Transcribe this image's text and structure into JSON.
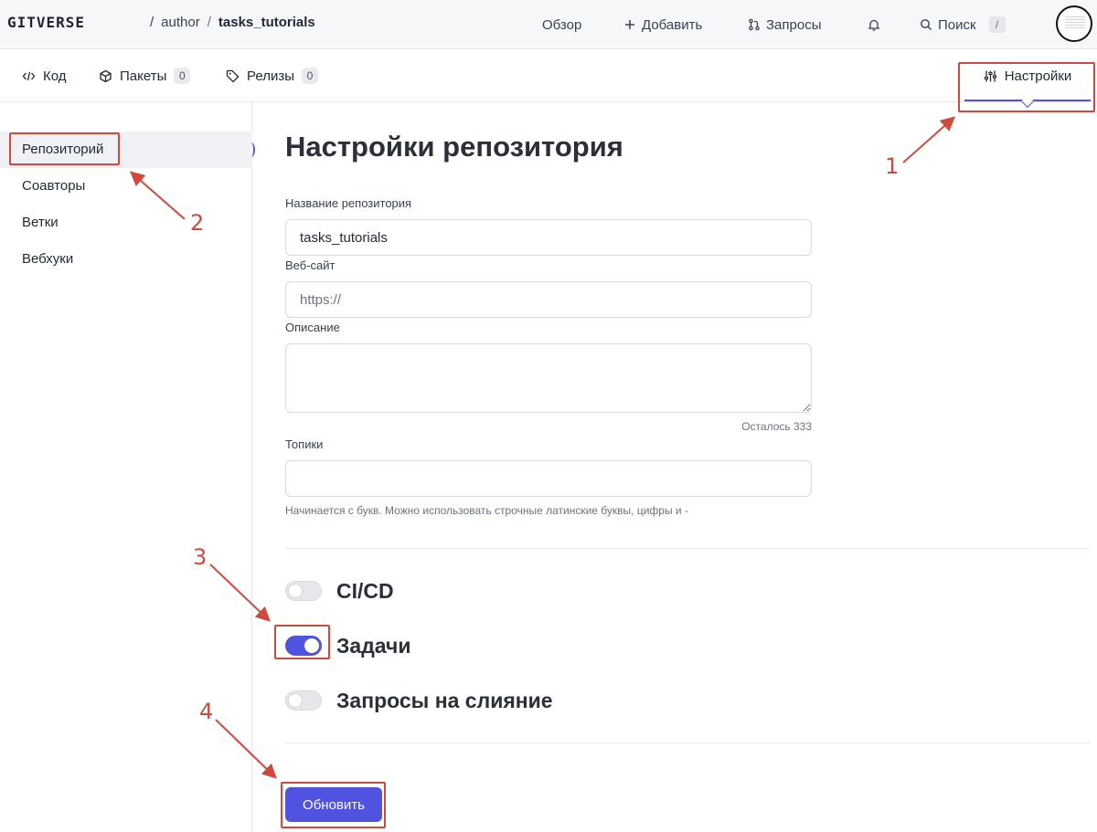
{
  "header": {
    "logo": "GITVERSE",
    "breadcrumb": {
      "owner": "author",
      "separator": "/",
      "repo": "tasks_tutorials"
    },
    "nav": {
      "overview": "Обзор",
      "add": "Добавить",
      "requests": "Запросы",
      "search": "Поиск",
      "search_shortcut": "/"
    }
  },
  "tabs": {
    "code": "Код",
    "packages": "Пакеты",
    "packages_count": "0",
    "releases": "Релизы",
    "releases_count": "0",
    "settings": "Настройки"
  },
  "sidebar": {
    "items": [
      {
        "label": "Репозиторий",
        "active": true
      },
      {
        "label": "Соавторы"
      },
      {
        "label": "Ветки"
      },
      {
        "label": "Вебхуки"
      }
    ]
  },
  "main": {
    "title": "Настройки репозитория",
    "repo_name_label": "Название репозитория",
    "repo_name_value": "tasks_tutorials",
    "website_label": "Веб-сайт",
    "website_placeholder": "https://",
    "description_label": "Описание",
    "description_value": "",
    "remaining": "Осталось 333",
    "topics_label": "Топики",
    "topics_value": "",
    "topics_hint": "Начинается с букв. Можно использовать строчные латинские буквы, цифры и -",
    "toggles": [
      {
        "label": "CI/CD",
        "on": false
      },
      {
        "label": "Задачи",
        "on": true
      },
      {
        "label": "Запросы на слияние",
        "on": false
      }
    ],
    "update_button": "Обновить"
  },
  "annotations": [
    "1",
    "2",
    "3",
    "4"
  ],
  "colors": {
    "accent": "#4f53e0",
    "annotation": "#cf4a3c"
  }
}
